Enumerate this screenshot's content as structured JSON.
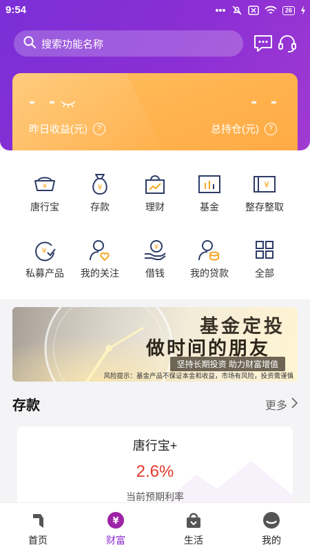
{
  "status_bar": {
    "time": "9:54",
    "battery": "26"
  },
  "search": {
    "placeholder": "搜索功能名称"
  },
  "summary_card": {
    "yesterday_value": "- -",
    "yesterday_label": "昨日收益(元)",
    "holdings_value": "- -",
    "holdings_label": "总持仓(元)",
    "help": "?"
  },
  "menu": [
    {
      "label": "唐行宝",
      "icon": "yuan-bowl-icon"
    },
    {
      "label": "存款",
      "icon": "money-bag-icon"
    },
    {
      "label": "理财",
      "icon": "shopping-bag-chart-icon"
    },
    {
      "label": "基金",
      "icon": "chart-frame-icon"
    },
    {
      "label": "整存整取",
      "icon": "yuan-bill-icon"
    },
    {
      "label": "私募产品",
      "icon": "yuan-check-circle-icon"
    },
    {
      "label": "我的关注",
      "icon": "user-heart-icon"
    },
    {
      "label": "借钱",
      "icon": "hand-coin-icon"
    },
    {
      "label": "我的贷款",
      "icon": "user-coins-icon"
    },
    {
      "label": "全部",
      "icon": "grid-icon"
    }
  ],
  "banner": {
    "title1": "基金定投",
    "title2": "做时间的朋友",
    "subtitle": "坚持长期投资  助力财富增值",
    "risk": "风险提示：基金产品不保证本金和收益，市场有风险，投资需谨慎"
  },
  "section": {
    "title": "存款",
    "more": "更多"
  },
  "product": {
    "name": "唐行宝+",
    "rate": "2.6%",
    "desc": "当前预期利率"
  },
  "tabs": [
    {
      "label": "首页",
      "icon": "home-icon"
    },
    {
      "label": "财富",
      "icon": "wealth-icon"
    },
    {
      "label": "生活",
      "icon": "life-bag-icon"
    },
    {
      "label": "我的",
      "icon": "profile-icon"
    }
  ],
  "colors": {
    "primary": "#8a2bd0",
    "card": "#ffb24d",
    "rate": "#e33a2e",
    "icon_navy": "#2c3a66",
    "icon_orange": "#f5a623"
  }
}
